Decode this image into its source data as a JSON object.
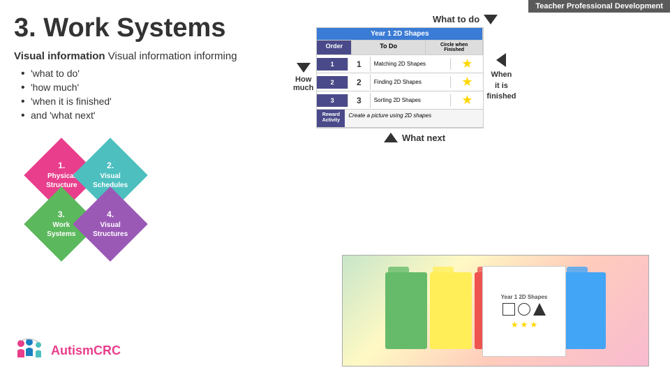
{
  "header": {
    "title": "Teacher Professional Development"
  },
  "slide": {
    "number": "3.",
    "title": "Work Systems",
    "subtitle": "Visual information informing",
    "bullets": [
      "'what to do'",
      "'how much'",
      "'when it is finished'",
      "and 'what next'"
    ]
  },
  "diamond_grid": {
    "items": [
      {
        "num": "1.",
        "label": "Physical\nStructure",
        "color": "pink",
        "position": "top-left"
      },
      {
        "num": "2.",
        "label": "Visual\nSchedules",
        "color": "teal",
        "position": "top-right"
      },
      {
        "num": "3.",
        "label": "Work\nSystems",
        "color": "green",
        "position": "bot-left"
      },
      {
        "num": "4.",
        "label": "Visual\nStructures",
        "color": "purple",
        "position": "bot-right"
      }
    ]
  },
  "work_system_table": {
    "title": "Year 1 2D Shapes",
    "headers": [
      "Order",
      "To Do",
      "Circle when Finished"
    ],
    "rows": [
      {
        "order": "1",
        "desc": "Matching 2D Shapes"
      },
      {
        "order": "2",
        "desc": "Finding 2D Shapes"
      },
      {
        "order": "3",
        "desc": "Sorting 2D Shapes"
      }
    ],
    "reward": {
      "label": "Reward Activity",
      "desc": "Create a picture using 2D shapes"
    }
  },
  "labels": {
    "what_to_do": "What to do",
    "how_much": "How\nmuch",
    "when_finished": "When\nit is\nfinished",
    "what_next": "What next"
  },
  "logo": {
    "text_part1": "Autism",
    "text_part2": "CRC"
  }
}
